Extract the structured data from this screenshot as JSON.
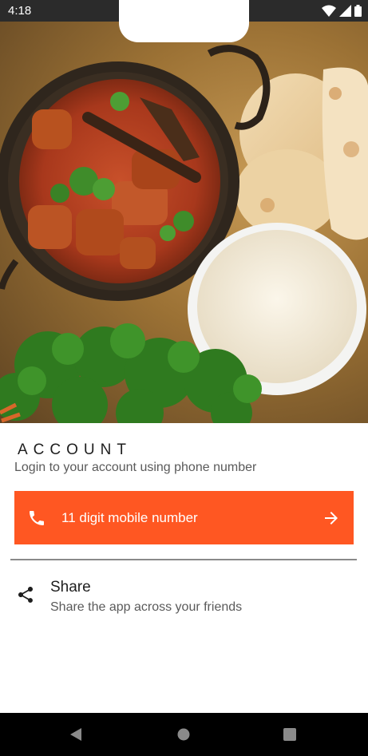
{
  "status_bar": {
    "time": "4:18",
    "icons": [
      "wifi-icon",
      "signal-icon",
      "battery-icon"
    ]
  },
  "hero": {
    "image_alt": "food-photo-curry-rice-flatbread"
  },
  "account": {
    "heading": "ACCOUNT",
    "subtitle": "Login to your account using phone number",
    "phone_button": {
      "label": "11 digit mobile number",
      "icon": "phone-icon",
      "trailing_icon": "arrow-right-icon"
    }
  },
  "share": {
    "title": "Share",
    "subtitle": "Share the app across your friends",
    "icon": "share-icon"
  },
  "nav_bar": {
    "buttons": [
      "back-icon",
      "home-icon",
      "recents-icon"
    ]
  },
  "colors": {
    "accent": "#ff5722",
    "status_bar_bg": "#2b2b2b",
    "nav_bar_bg": "#000000",
    "text_primary": "#1e1e1e",
    "text_secondary": "#5a5a5a"
  }
}
